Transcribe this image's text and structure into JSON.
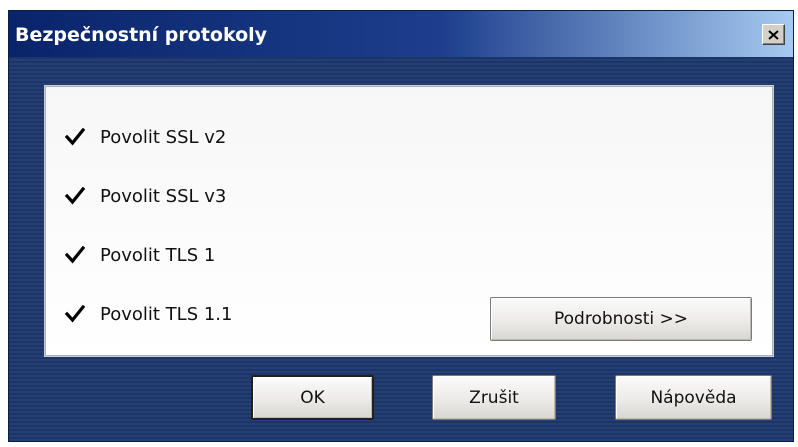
{
  "dialog": {
    "title": "Bezpečnostní protokoly",
    "close_glyph": "close-icon"
  },
  "options": [
    {
      "label": "Povolit SSL v2",
      "checked": true
    },
    {
      "label": "Povolit SSL v3",
      "checked": true
    },
    {
      "label": "Povolit TLS 1",
      "checked": true
    },
    {
      "label": "Povolit TLS 1.1",
      "checked": true
    }
  ],
  "buttons": {
    "details": "Podrobnosti >>",
    "ok": "OK",
    "cancel": "Zrušit",
    "help": "Nápověda"
  },
  "colors": {
    "titlebar_start": "#0a246a",
    "titlebar_end": "#a6caf0",
    "window_background": "#243f73",
    "panel_background": "#ffffff"
  }
}
